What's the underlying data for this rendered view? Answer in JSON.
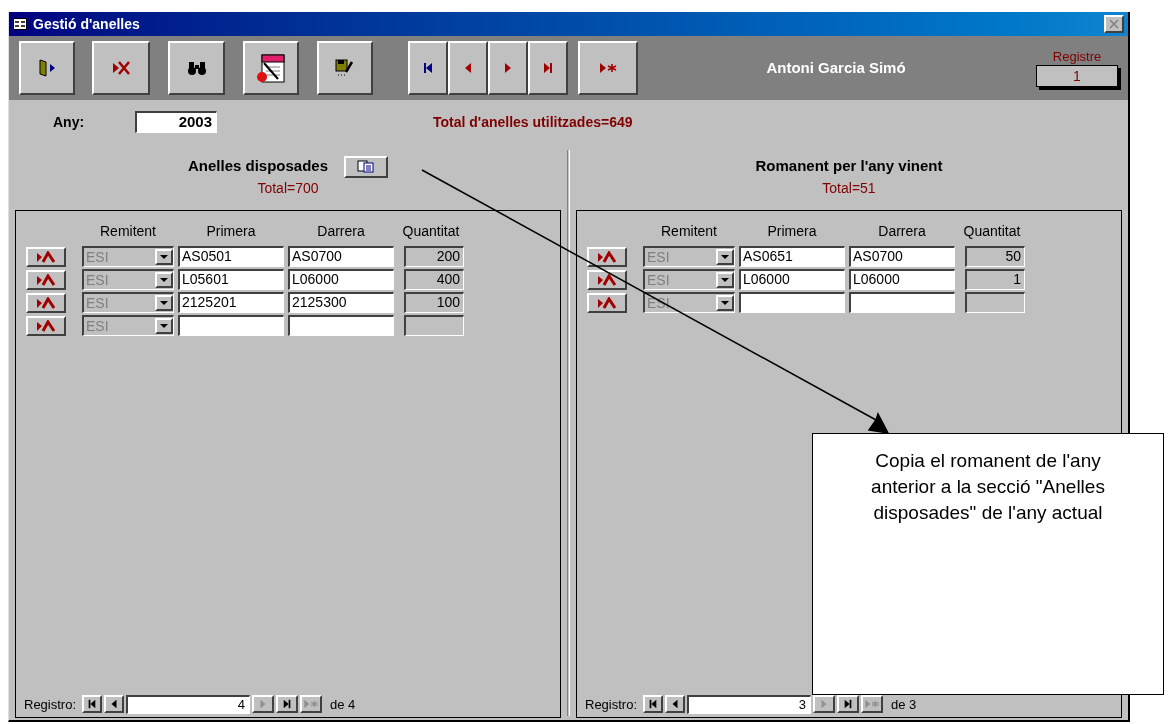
{
  "window": {
    "title": "Gestió d'anelles"
  },
  "toolbar": {
    "user": "Antoni Garcia Simó",
    "record_label": "Registre",
    "record_value": "1"
  },
  "year": {
    "label": "Any:",
    "value": "2003"
  },
  "total_used": "Total d'anelles utilitzades=649",
  "panels": [
    {
      "title": "Anelles disposades",
      "total": "Total=700",
      "copy_button": true,
      "columns": [
        "Remitent",
        "Primera",
        "Darrera",
        "Quantitat"
      ],
      "rows": [
        {
          "sender": "ESI",
          "first": "AS0501",
          "last": "AS0700",
          "quantity": "200"
        },
        {
          "sender": "ESI",
          "first": "L05601",
          "last": "L06000",
          "quantity": "400"
        },
        {
          "sender": "ESI",
          "first": "2125201",
          "last": "2125300",
          "quantity": "100"
        },
        {
          "sender": "ESI"
        }
      ],
      "navigator": {
        "label": "Registro:",
        "current": "4",
        "of": "de 4",
        "buttons": [
          {
            "kind": "first",
            "disabled": false
          },
          {
            "kind": "prev",
            "disabled": false
          },
          {
            "kind": "next",
            "disabled": true
          },
          {
            "kind": "last",
            "disabled": false
          },
          {
            "kind": "new",
            "disabled": true
          }
        ]
      }
    },
    {
      "title": "Romanent per l'any vinent",
      "total": "Total=51",
      "copy_button": false,
      "columns": [
        "Remitent",
        "Primera",
        "Darrera",
        "Quantitat"
      ],
      "rows": [
        {
          "sender": "ESI",
          "first": "AS0651",
          "last": "AS0700",
          "quantity": "50"
        },
        {
          "sender": "ESI",
          "first": "L06000",
          "last": "L06000",
          "quantity": "1"
        },
        {
          "sender": "ESI"
        }
      ],
      "navigator": {
        "label": "Registro:",
        "current": "3",
        "of": "de 3",
        "buttons": [
          {
            "kind": "first",
            "disabled": false
          },
          {
            "kind": "prev",
            "disabled": false
          },
          {
            "kind": "next",
            "disabled": true
          },
          {
            "kind": "last",
            "disabled": false
          },
          {
            "kind": "new",
            "disabled": true
          }
        ]
      }
    }
  ],
  "callout": {
    "text": "Copia el romanent de l'any anterior a la secció \"Anelles disposades\" de l'any actual"
  }
}
